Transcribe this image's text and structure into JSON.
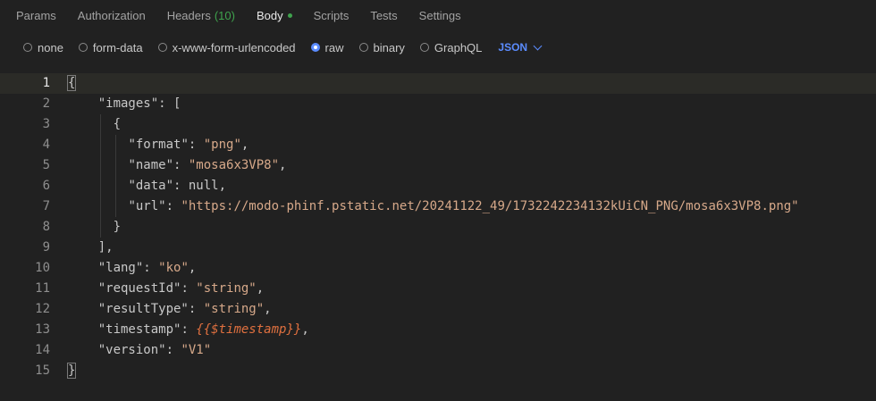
{
  "tabs": [
    {
      "label": "Params"
    },
    {
      "label": "Authorization"
    },
    {
      "label": "Headers",
      "count": "(10)"
    },
    {
      "label": "Body"
    },
    {
      "label": "Scripts"
    },
    {
      "label": "Tests"
    },
    {
      "label": "Settings"
    }
  ],
  "body_types": [
    "none",
    "form-data",
    "x-www-form-urlencoded",
    "raw",
    "binary",
    "GraphQL"
  ],
  "selected_body_type": "raw",
  "language": "JSON",
  "editor": {
    "line_numbers": [
      "1",
      "2",
      "3",
      "4",
      "5",
      "6",
      "7",
      "8",
      "9",
      "10",
      "11",
      "12",
      "13",
      "14",
      "15"
    ],
    "lines": [
      "{",
      "    \"images\": [",
      "      {",
      "        \"format\": \"png\",",
      "        \"name\": \"mosa6x3VP8\",",
      "        \"data\": null,",
      "        \"url\": \"https://modo-phinf.pstatic.net/20241122_49/1732242234132kUiCN_PNG/mosa6x3VP8.png\"",
      "      }",
      "    ],",
      "    \"lang\": \"ko\",",
      "    \"requestId\": \"string\",",
      "    \"resultType\": \"string\",",
      "    \"timestamp\": {{$timestamp}},",
      "    \"version\": \"V1\"",
      "}"
    ]
  },
  "colors": {
    "accent": "#5b8cff",
    "status_green": "#3fa34d",
    "string": "#d7a98a",
    "template_var": "#e0703f"
  }
}
